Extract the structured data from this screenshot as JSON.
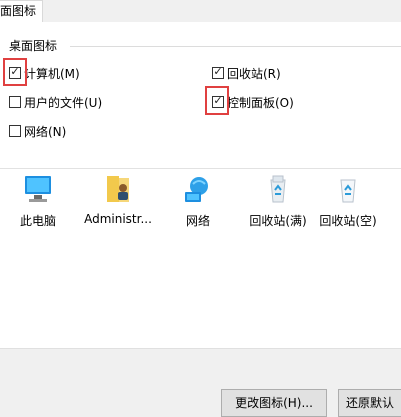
{
  "tab": {
    "label": "面图标"
  },
  "group": {
    "title": "桌面图标"
  },
  "checkboxes": [
    {
      "label": "计算机(M)",
      "checked": true
    },
    {
      "label": "回收站(R)",
      "checked": true
    },
    {
      "label": "用户的文件(U)",
      "checked": false
    },
    {
      "label": "控制面板(O)",
      "checked": true
    },
    {
      "label": "网络(N)",
      "checked": false
    }
  ],
  "icons": [
    {
      "label": "此电脑",
      "icon": "computer-icon"
    },
    {
      "label": "Administr...",
      "icon": "user-folder-icon"
    },
    {
      "label": "网络",
      "icon": "network-icon"
    },
    {
      "label": "回收站(满)",
      "icon": "recycle-bin-full-icon"
    },
    {
      "label": "回收站(空)",
      "icon": "recycle-bin-empty-icon"
    }
  ],
  "buttons": {
    "change_icon": "更改图标(H)...",
    "restore_default": "还原默认"
  },
  "colors": {
    "highlight": "#e04040"
  }
}
